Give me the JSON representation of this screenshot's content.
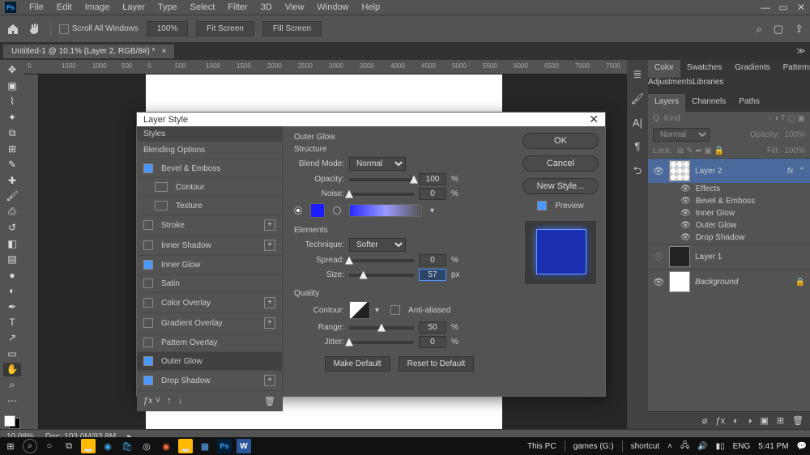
{
  "menu": [
    "File",
    "Edit",
    "Image",
    "Layer",
    "Type",
    "Select",
    "Filter",
    "3D",
    "View",
    "Window",
    "Help"
  ],
  "options": {
    "scroll_all": "Scroll All Windows",
    "zoom": "100%",
    "fit": "Fit Screen",
    "fill": "Fill Screen"
  },
  "doc_tab": "Untitled-1 @ 10.1% (Layer 2, RGB/8#) *",
  "ruler": [
    "0",
    "1500",
    "1000",
    "500",
    "0",
    "500",
    "1000",
    "1500",
    "2000",
    "2500",
    "3000",
    "3500",
    "4000",
    "4500",
    "5000",
    "5500",
    "6000",
    "6500",
    "7000",
    "7500"
  ],
  "rpanel_top": [
    "Color",
    "Swatches",
    "Gradients",
    "Patterns"
  ],
  "rpanel_mid": [
    "Adjustments",
    "Libraries"
  ],
  "rpanel_layers": [
    "Layers",
    "Channels",
    "Paths"
  ],
  "layers": {
    "kind": "Kind",
    "mode": "Normal",
    "opacity_lbl": "Opacity:",
    "opacity": "100%",
    "lock_lbl": "Lock:",
    "fill_lbl": "Fill:",
    "fill": "100%",
    "items": [
      {
        "name": "Layer 2"
      },
      {
        "name": "Layer 1"
      },
      {
        "name": "Background"
      }
    ],
    "fx_label": "fx",
    "effects_hdr": "Effects",
    "effects": [
      "Bevel & Emboss",
      "Inner Glow",
      "Outer Glow",
      "Drop Shadow"
    ]
  },
  "dialog": {
    "title": "Layer Style",
    "styles_hdr": "Styles",
    "blending": "Blending Options",
    "styles": [
      {
        "label": "Bevel & Emboss",
        "chk": true,
        "plus": false
      },
      {
        "label": "Contour",
        "chk": false,
        "sub": true
      },
      {
        "label": "Texture",
        "chk": false,
        "sub": true
      },
      {
        "label": "Stroke",
        "chk": false,
        "plus": true
      },
      {
        "label": "Inner Shadow",
        "chk": false,
        "plus": true
      },
      {
        "label": "Inner Glow",
        "chk": true
      },
      {
        "label": "Satin",
        "chk": false
      },
      {
        "label": "Color Overlay",
        "chk": false,
        "plus": true
      },
      {
        "label": "Gradient Overlay",
        "chk": false,
        "plus": true
      },
      {
        "label": "Pattern Overlay",
        "chk": false
      },
      {
        "label": "Outer Glow",
        "chk": true,
        "sel": true
      },
      {
        "label": "Drop Shadow",
        "chk": true,
        "plus": true
      }
    ],
    "center": {
      "title": "Outer Glow",
      "structure": "Structure",
      "blend_mode_lbl": "Blend Mode:",
      "blend_mode": "Normal",
      "opacity_lbl": "Opacity:",
      "opacity": "100",
      "noise_lbl": "Noise:",
      "noise": "0",
      "pct": "%",
      "px": "px",
      "elements": "Elements",
      "technique_lbl": "Technique:",
      "technique": "Softer",
      "spread_lbl": "Spread:",
      "spread": "0",
      "size_lbl": "Size:",
      "size": "57",
      "quality": "Quality",
      "contour_lbl": "Contour:",
      "aa": "Anti-aliased",
      "range_lbl": "Range:",
      "range": "50",
      "jitter_lbl": "Jitter:",
      "jitter": "0",
      "make_default": "Make Default",
      "reset_default": "Reset to Default"
    },
    "ok": "OK",
    "cancel": "Cancel",
    "new_style": "New Style...",
    "preview_lbl": "Preview"
  },
  "status": {
    "zoom": "10.08%",
    "doc_lbl": "Doc:",
    "doc": "103.0M/93.8M"
  },
  "taskbar": {
    "items": [
      "This PC",
      "games (G:)",
      "shortcut"
    ],
    "lang": "ENG",
    "time": "5:41 PM"
  }
}
